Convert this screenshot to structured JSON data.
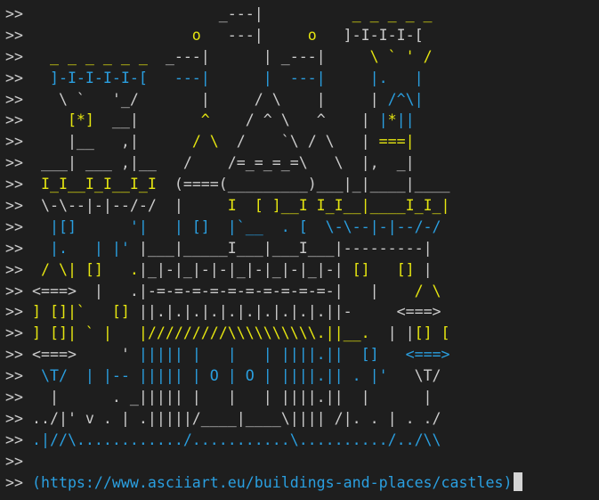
{
  "terminal": {
    "prompt": ">>",
    "colors": {
      "background": "#1e1e1e",
      "default": "#cccccc",
      "yellow": "#e5e510",
      "blue": "#2a9fe0"
    },
    "lines": [
      [
        [
          "g",
          "                     _---|"
        ],
        [
          "y",
          "          _ _ _ _ _"
        ]
      ],
      [
        [
          "y",
          "                  o"
        ],
        [
          "g",
          "   ---|"
        ],
        [
          "y",
          "     o"
        ],
        [
          "g",
          "   ]-I-I-I-["
        ]
      ],
      [
        [
          "y",
          "  _ _ _ _ _ _"
        ],
        [
          "g",
          "  _---|      | _---|"
        ],
        [
          "y",
          "     \\ ` ' /"
        ]
      ],
      [
        [
          "b",
          "  ]-I-I-I-I-["
        ],
        [
          "b",
          "   ---|      |  ---|"
        ],
        [
          "b",
          "     |.   |"
        ]
      ],
      [
        [
          "g",
          "   \\ `   '_/"
        ],
        [
          "g",
          "       |     / \\    |     |"
        ],
        [
          "b",
          " /^\\|"
        ]
      ],
      [
        [
          "y",
          "    [*]"
        ],
        [
          "g",
          "  __|"
        ],
        [
          "y",
          "       ^"
        ],
        [
          "g",
          "    / ^ \\   ^    |"
        ],
        [
          "b",
          " |"
        ],
        [
          "y",
          "*"
        ],
        [
          "b",
          "||"
        ]
      ],
      [
        [
          "g",
          "    |__   ,|"
        ],
        [
          "y",
          "      / \\"
        ],
        [
          "g",
          "  /    `\\ / \\   |"
        ],
        [
          "y",
          " ===|"
        ]
      ],
      [
        [
          "g",
          " ___| ___ ,|__   /    /=_=_=_=\\   \\  |,  _|"
        ]
      ],
      [
        [
          "y",
          " I_I__I_I__I_I"
        ],
        [
          "g",
          "  (====(_________)___|_|____|____"
        ]
      ],
      [
        [
          "g",
          " \\-\\--|-|--/-/  |"
        ],
        [
          "y",
          "     I  [ ]__I I_I__|____I_I_|"
        ]
      ],
      [
        [
          "b",
          "  |[]      '|   | []  |`__  . [  \\-\\--|-|--/-/"
        ]
      ],
      [
        [
          "b",
          "  |.   | |' "
        ],
        [
          "g",
          "|___|_____I___|___I___|---------|"
        ]
      ],
      [
        [
          "y",
          " / \\| []   ."
        ],
        [
          "g",
          "|_|-|_|-|-|_|-|_|-|_|-|"
        ],
        [
          "y",
          " []   []"
        ],
        [
          "g",
          " |"
        ]
      ],
      [
        [
          "g",
          "<===>  |   ."
        ],
        [
          "g",
          "|-=-=-=-=-=-=-=-=-=-=-|   |    "
        ],
        [
          "y",
          "/ \\"
        ]
      ],
      [
        [
          "y",
          "] []|`   []"
        ],
        [
          "g",
          " ||.|.|.|.|.|.|.|.|.|.||-     <===>"
        ]
      ],
      [
        [
          "y",
          "] []| ` |   |/////////\\\\\\\\\\\\\\\\\\\\.||__."
        ],
        [
          "g",
          "  | |"
        ],
        [
          "y",
          "[] ["
        ]
      ],
      [
        [
          "g",
          "<===>     ' "
        ],
        [
          "b",
          "||||| |   |   | ||||.||  []   <===>"
        ]
      ],
      [
        [
          "b",
          " \\T/  | |-- ||||| | O | O | ||||.|| . |'   "
        ],
        [
          "g",
          "\\T/"
        ]
      ],
      [
        [
          "g",
          "  |      . _||||| |   |   | ||||.||  |      |"
        ]
      ],
      [
        [
          "g",
          "../|' v . | .|||||/____|____\\|||| /|. . | . ./"
        ]
      ],
      [
        [
          "b",
          ".|//\\............/...........\\........../../\\\\"
        ]
      ],
      [],
      [
        [
          "b",
          "(https://www.asciiart.eu/buildings-and-places/castles)"
        ]
      ]
    ]
  }
}
